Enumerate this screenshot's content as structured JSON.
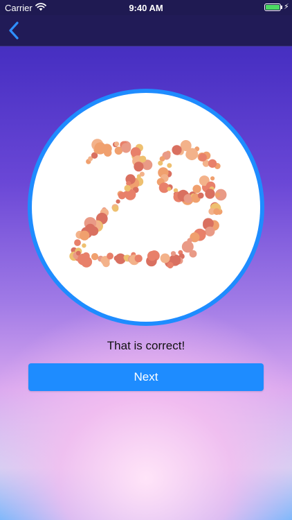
{
  "status_bar": {
    "carrier": "Carrier",
    "time": "9:40 AM",
    "battery_level": 1.0,
    "battery_color": "#4cd964",
    "wifi_icon": "wifi-icon",
    "charging_icon": "bolt-icon"
  },
  "nav": {
    "back_icon": "chevron-left-icon",
    "background": "#211b57"
  },
  "plate": {
    "number": "29",
    "ring_color": "#1e8cff",
    "dot_colors": [
      "#e8806a",
      "#f0a06e",
      "#eec070",
      "#e99a86",
      "#d97060",
      "#f3b28a"
    ]
  },
  "result": {
    "message": "That is correct!"
  },
  "actions": {
    "next_label": "Next",
    "accent": "#1e8cff"
  }
}
